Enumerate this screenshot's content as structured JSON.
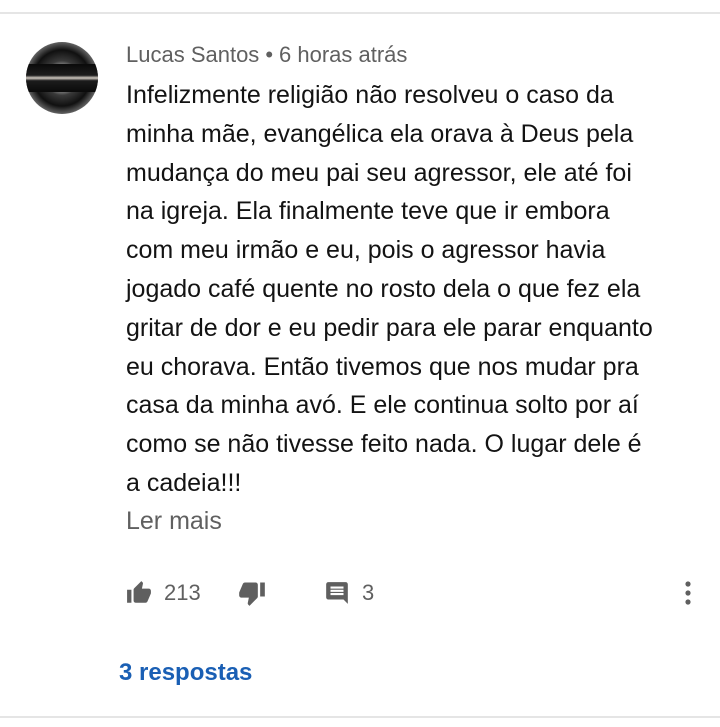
{
  "comment": {
    "author": "Lucas Santos",
    "separator": "•",
    "time": "6 horas atrás",
    "lines": [
      "Infelizmente religião não resolveu o caso da",
      "minha mãe, evangélica ela orava à Deus pela",
      "mudança do meu pai seu agressor, ele até foi",
      "na igreja. Ela finalmente teve que ir embora",
      "com meu irmão e eu, pois o agressor havia",
      "jogado café quente no rosto dela o que fez ela",
      "gritar de dor e eu pedir para ele parar enquanto",
      "eu chorava. Então tivemos que nos mudar pra",
      "casa da minha avó. E ele continua solto por aí",
      "como se não tivesse feito nada. O lugar dele é",
      "a cadeia!!!"
    ],
    "read_more": "Ler mais",
    "likes": "213",
    "replies_count": "3",
    "replies_link": "3 respostas"
  },
  "icons": {
    "like": "thumbs-up-icon",
    "dislike": "thumbs-down-icon",
    "reply": "comment-icon",
    "more": "more-vertical-icon"
  },
  "colors": {
    "link": "#1a5fb4",
    "secondary_text": "#606060",
    "icon": "#5f5f5f"
  }
}
